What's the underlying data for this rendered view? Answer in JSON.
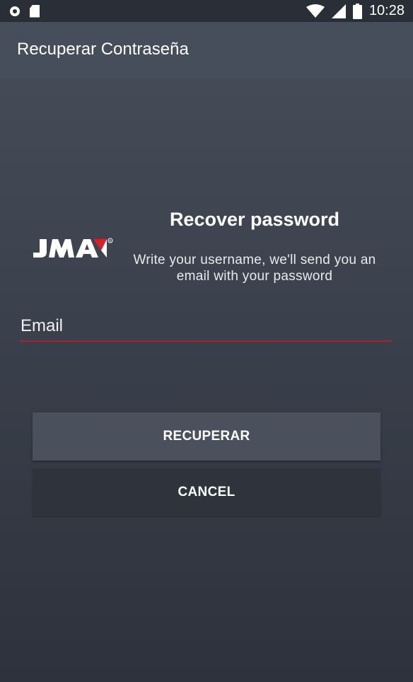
{
  "status_bar": {
    "time": "10:28",
    "icons": [
      "notification-circle-icon",
      "sd-card-icon",
      "wifi-icon",
      "cell-signal-icon",
      "battery-icon"
    ]
  },
  "app_bar": {
    "title": "Recuperar Contraseña"
  },
  "brand": {
    "logo_text": "JMA",
    "accent_color": "#d8222b"
  },
  "form": {
    "heading": "Recover password",
    "subtext": "Write your username, we'll send you an email with your password",
    "email": {
      "placeholder": "Email",
      "value": ""
    },
    "recover_label": "RECUPERAR",
    "cancel_label": "CANCEL"
  },
  "colors": {
    "status_bar": "#2a2f37",
    "app_bar": "#474e5b",
    "background": "#3a404b",
    "underline": "#b0202b"
  }
}
